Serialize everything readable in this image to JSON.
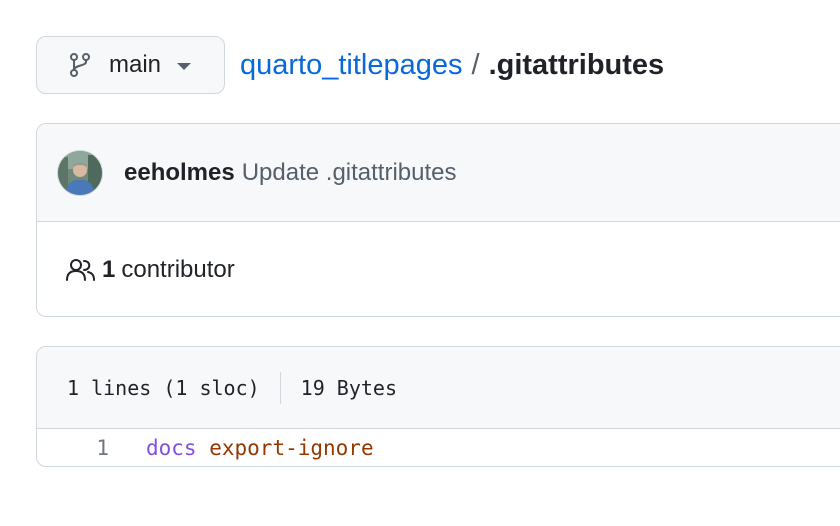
{
  "branch": {
    "name": "main",
    "icon": "git-branch-icon"
  },
  "breadcrumb": {
    "repo": "quarto_titlepages",
    "separator": "/",
    "file": ".gitattributes"
  },
  "commit": {
    "author": "eeholmes",
    "message": "Update .gitattributes",
    "avatar_icon": "user-avatar"
  },
  "contributors": {
    "icon": "people-icon",
    "count": "1",
    "label": "contributor"
  },
  "file": {
    "lines_info": "1 lines (1 sloc)",
    "size": "19 Bytes",
    "code_lines": [
      {
        "number": "1",
        "pattern": "docs",
        "attribute": "export-ignore"
      }
    ]
  },
  "colors": {
    "link": "#0969da",
    "pattern": "#8250df",
    "attribute": "#953800",
    "border": "#d0d7de",
    "header_bg": "#f6f8fa"
  }
}
